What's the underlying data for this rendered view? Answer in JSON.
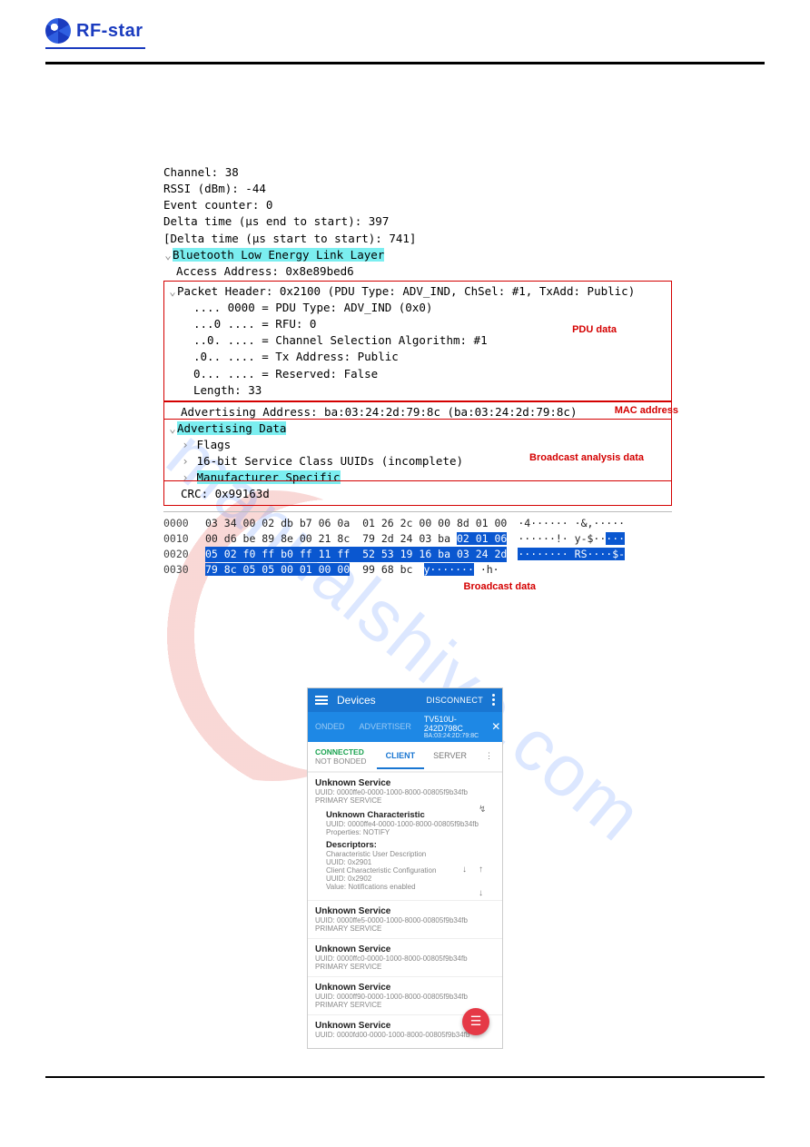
{
  "logo_text": "RF-star",
  "packet": {
    "channel": "Channel: 38",
    "rssi": "RSSI (dBm): -44",
    "evcnt": "Event counter: 0",
    "delta_end": "Delta time (µs end to start): 397",
    "delta_start": "[Delta time (µs start to start): 741]",
    "ble_ll": "Bluetooth Low Energy Link Layer",
    "access": "Access Address: 0x8e89bed6",
    "pkt_header": "Packet Header: 0x2100 (PDU Type: ADV_IND, ChSel: #1, TxAdd: Public)",
    "pdu_type": ".... 0000 = PDU Type: ADV_IND (0x0)",
    "rfu": "...0 .... = RFU: 0",
    "chsel": "..0. .... = Channel Selection Algorithm: #1",
    "txaddr": ".0.. .... = Tx Address: Public",
    "reserved": "0... .... = Reserved: False",
    "length": "Length: 33",
    "adv_addr": "Advertising Address: ba:03:24:2d:79:8c (ba:03:24:2d:79:8c)",
    "adv_data": "Advertising Data",
    "flags": "Flags",
    "uuids16": "16-bit Service Class UUIDs (incomplete)",
    "mfg": "Manufacturer Specific",
    "crc": "CRC: 0x99163d"
  },
  "ann": {
    "pdu": "PDU data",
    "mac": "MAC address",
    "analysis": "Broadcast analysis data",
    "bdata": "Broadcast data"
  },
  "hex": {
    "r0": {
      "off": "0000",
      "b": "03 34 00 02 db b7 06 0a  01 26 2c 00 00 8d 01 00",
      "a": "·4······ ·&,·····"
    },
    "r1": {
      "off": "0010",
      "b1": "00 d6 be 89 8e 00 21 8c  79 2d 24 03 ba ",
      "b2": "02 01 06",
      "a1": "······!· y-$··",
      "a2": "···"
    },
    "r2": {
      "off": "0020",
      "b": "05 02 f0 ff b0 ff 11 ff  52 53 19 16 ba 03 24 2d",
      "a1": "········ ",
      "a2": "RS····$-"
    },
    "r3": {
      "off": "0030",
      "b1": "79 8c 05 05 00 01 00 00",
      "b2": "  99 68 bc",
      "a1": "y·······",
      "a2": " ·h·"
    }
  },
  "phone": {
    "title": "Devices",
    "disconnect": "DISCONNECT",
    "tab_bonded": "ONDED",
    "tab_adv": "ADVERTISER",
    "dev_name": "TV510U-242D798C",
    "dev_addr": "BA:03:24:2D:79:8C",
    "connected": "CONNECTED",
    "not_bonded": "NOT BONDED",
    "client": "CLIENT",
    "server": "SERVER",
    "svc_unknown": "Unknown Service",
    "primary": "PRIMARY SERVICE",
    "svc1_uuid": "UUID: 0000ffe0-0000-1000-8000-00805f9b34fb",
    "char_unknown": "Unknown Characteristic",
    "char_uuid": "UUID: 0000ffe4-0000-1000-8000-00805f9b34fb",
    "char_props": "Properties: NOTIFY",
    "desc_label": "Descriptors:",
    "desc_cud": "Characteristic User Description",
    "desc_cud_uuid": "UUID: 0x2901",
    "desc_ccc": "Client Characteristic Configuration",
    "desc_ccc_uuid": "UUID: 0x2902",
    "desc_ccc_val": "Value: Notifications enabled",
    "svc2_uuid": "UUID: 0000ffe5-0000-1000-8000-00805f9b34fb",
    "svc3_uuid": "UUID: 0000ffc0-0000-1000-8000-00805f9b34fb",
    "svc4_uuid": "UUID: 0000ff90-0000-1000-8000-00805f9b34fb",
    "svc5_uuid": "UUID: 0000fd00-0000-1000-8000-00805f9b34fb"
  }
}
